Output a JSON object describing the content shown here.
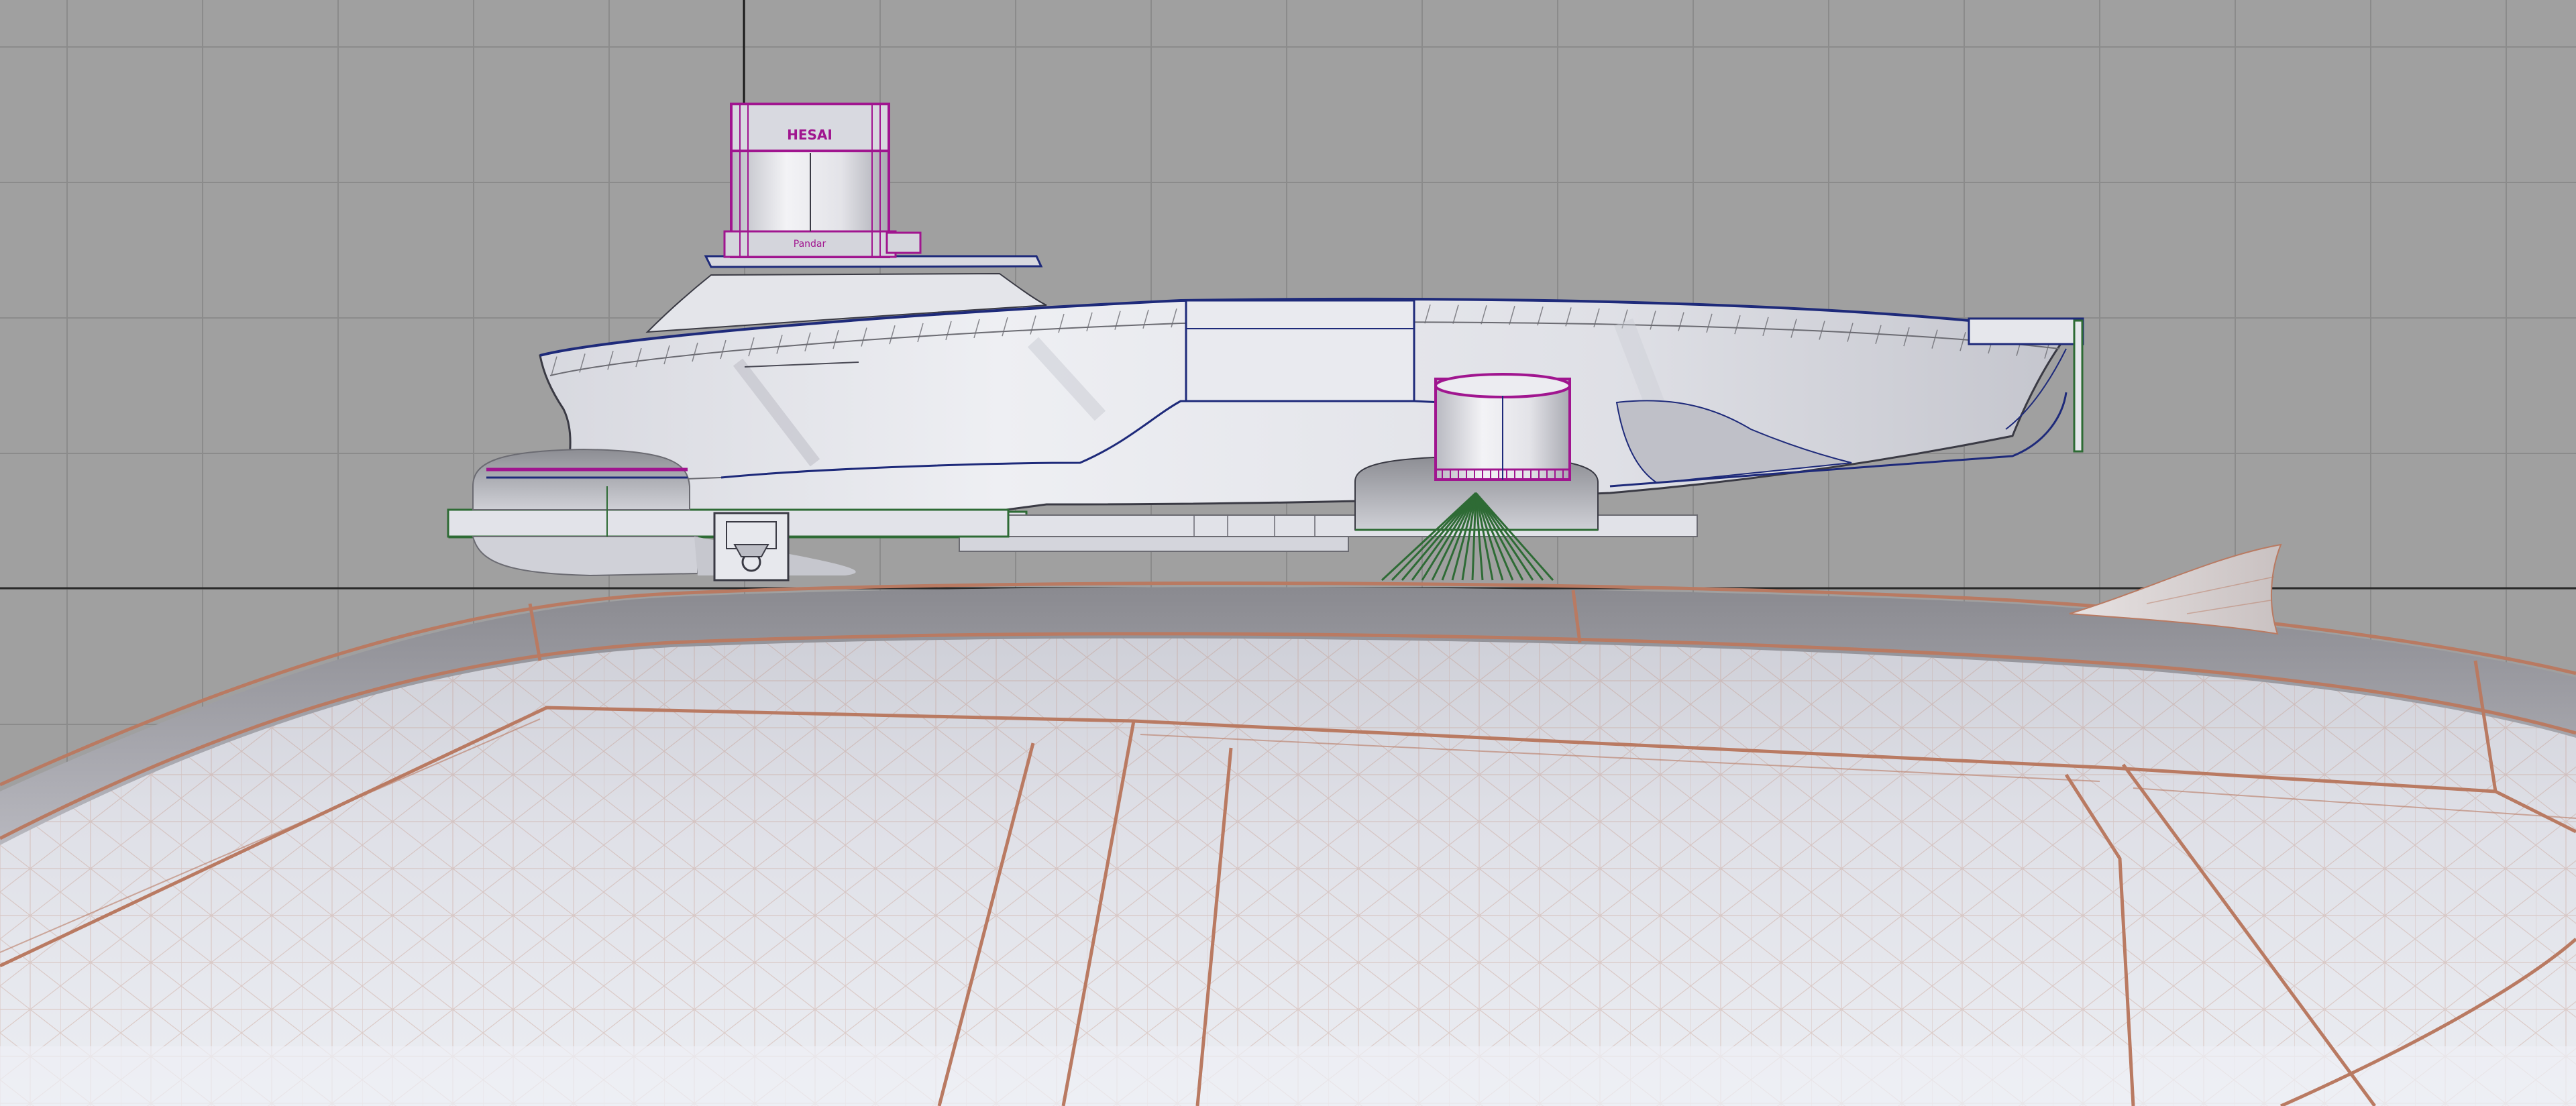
{
  "viewport": {
    "background_color": "#a0a0a0",
    "grid_color": "#8b8b8b",
    "horizon_color": "#2a2a2a",
    "view_type": "elevation",
    "grid_visible": true
  },
  "colors": {
    "selection_magenta": "#a0158f",
    "edge_navy": "#1e2a7a",
    "edge_green": "#2e6b35",
    "mesh_copper": "#b97a62",
    "surface_light": "#e6e7ec",
    "surface_mid": "#c9cad2",
    "surface_dark": "#6b6b72"
  },
  "objects": {
    "lidar_top": {
      "icon": "lidar-sensor-icon",
      "brand_label": "HESAI",
      "base_label": "Pandar",
      "selected": true
    },
    "sensor_housing": {
      "icon": "sensor-pod-icon"
    },
    "lidar_side": {
      "icon": "lidar-sensor-icon",
      "selected": true
    },
    "dome_sensor": {
      "icon": "dome-sensor-icon"
    },
    "mount_bracket": {
      "icon": "bracket-icon"
    },
    "shark_fin_antenna": {
      "icon": "shark-fin-antenna-icon"
    },
    "vehicle_roof": {
      "icon": "vehicle-roof-mesh-icon",
      "render_mode": "wireframe-shaded"
    }
  }
}
